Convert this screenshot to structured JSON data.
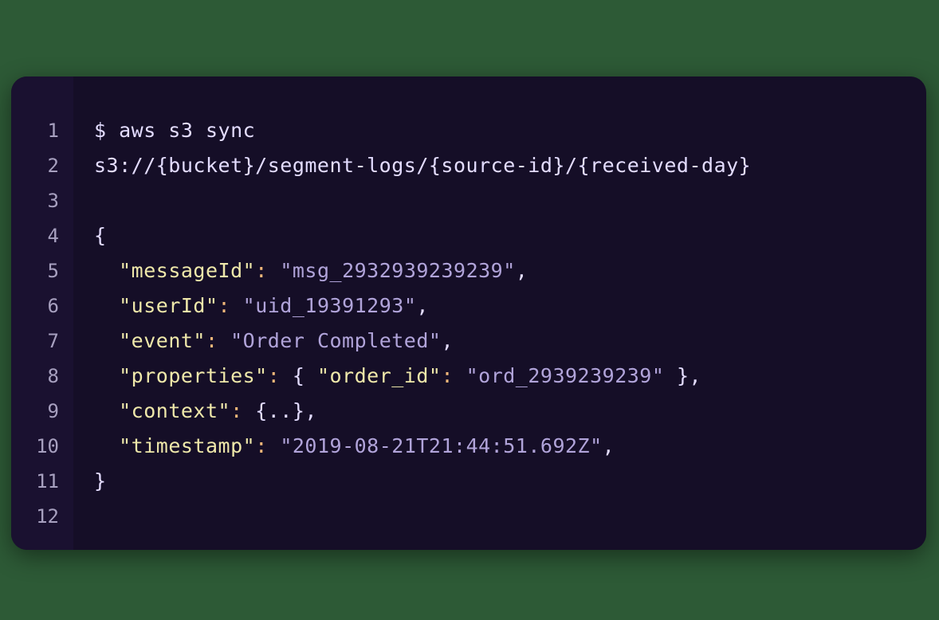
{
  "code": {
    "lines": [
      {
        "n": "1",
        "segments": [
          {
            "cls": "plain",
            "text": "$ aws s3 sync"
          }
        ]
      },
      {
        "n": "2",
        "segments": [
          {
            "cls": "plain",
            "text": "s3://{bucket}/segment-logs/{source-id}/{received-day}"
          }
        ]
      },
      {
        "n": "3",
        "segments": []
      },
      {
        "n": "4",
        "segments": [
          {
            "cls": "punc",
            "text": "{"
          }
        ]
      },
      {
        "n": "5",
        "segments": [
          {
            "cls": "punc",
            "text": "  "
          },
          {
            "cls": "key",
            "text": "\"messageId\""
          },
          {
            "cls": "orange",
            "text": ":"
          },
          {
            "cls": "punc",
            "text": " "
          },
          {
            "cls": "val",
            "text": "\"msg_2932939239239\""
          },
          {
            "cls": "punc",
            "text": ","
          }
        ]
      },
      {
        "n": "6",
        "segments": [
          {
            "cls": "punc",
            "text": "  "
          },
          {
            "cls": "key",
            "text": "\"userId\""
          },
          {
            "cls": "orange",
            "text": ":"
          },
          {
            "cls": "punc",
            "text": " "
          },
          {
            "cls": "val",
            "text": "\"uid_19391293\""
          },
          {
            "cls": "punc",
            "text": ","
          }
        ]
      },
      {
        "n": "7",
        "segments": [
          {
            "cls": "punc",
            "text": "  "
          },
          {
            "cls": "key",
            "text": "\"event\""
          },
          {
            "cls": "orange",
            "text": ":"
          },
          {
            "cls": "punc",
            "text": " "
          },
          {
            "cls": "val",
            "text": "\"Order Completed\""
          },
          {
            "cls": "punc",
            "text": ","
          }
        ]
      },
      {
        "n": "8",
        "segments": [
          {
            "cls": "punc",
            "text": "  "
          },
          {
            "cls": "key",
            "text": "\"properties\""
          },
          {
            "cls": "orange",
            "text": ":"
          },
          {
            "cls": "punc",
            "text": " { "
          },
          {
            "cls": "key",
            "text": "\"order_id\""
          },
          {
            "cls": "orange",
            "text": ":"
          },
          {
            "cls": "punc",
            "text": " "
          },
          {
            "cls": "val",
            "text": "\"ord_2939239239\""
          },
          {
            "cls": "punc",
            "text": " },"
          }
        ]
      },
      {
        "n": "9",
        "segments": [
          {
            "cls": "punc",
            "text": "  "
          },
          {
            "cls": "key",
            "text": "\"context\""
          },
          {
            "cls": "orange",
            "text": ":"
          },
          {
            "cls": "punc",
            "text": " {"
          },
          {
            "cls": "dots",
            "text": ".."
          },
          {
            "cls": "punc",
            "text": "},"
          }
        ]
      },
      {
        "n": "10",
        "segments": [
          {
            "cls": "punc",
            "text": "  "
          },
          {
            "cls": "key",
            "text": "\"timestamp\""
          },
          {
            "cls": "orange",
            "text": ":"
          },
          {
            "cls": "punc",
            "text": " "
          },
          {
            "cls": "val",
            "text": "\"2019-08-21T21:44:51.692Z\""
          },
          {
            "cls": "punc",
            "text": ","
          }
        ]
      },
      {
        "n": "11",
        "segments": [
          {
            "cls": "punc",
            "text": "}"
          }
        ]
      },
      {
        "n": "12",
        "segments": []
      }
    ]
  }
}
